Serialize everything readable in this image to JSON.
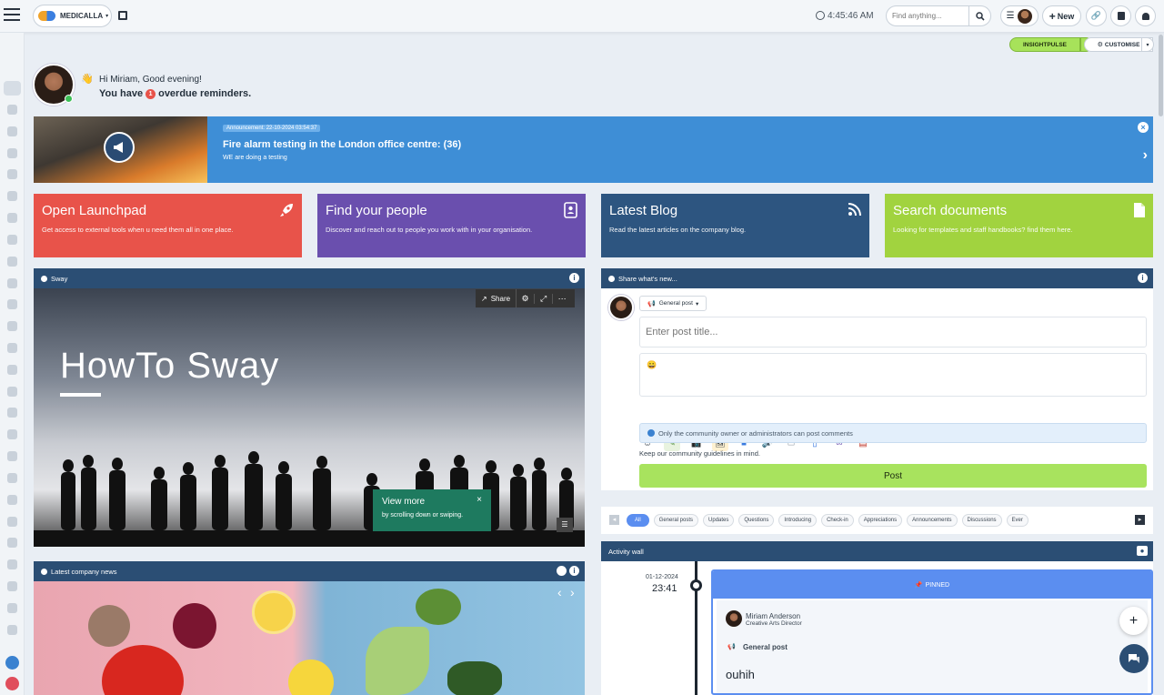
{
  "topbar": {
    "brand": "MEDICALLA",
    "time": "4:45:46 AM",
    "search_placeholder": "Find anything...",
    "new_label": "New"
  },
  "greeting": {
    "hello": "Hi Miriam, Good evening!",
    "reminder_prefix": "You have",
    "reminder_count": "1",
    "reminder_suffix": "overdue reminders."
  },
  "toolbar": {
    "insight_label": "INSIGHTPULSE",
    "customise_label": "CUSTOMISE"
  },
  "announcement": {
    "badge": "Announcement: 22-10-2024 03:54:37",
    "title": "Fire alarm testing in the London office centre: (36)",
    "text": "WE are doing a testing"
  },
  "quick_cards": [
    {
      "title": "Open Launchpad",
      "desc": "Get access to external tools when u need them all in one place.",
      "color": "#e8534a"
    },
    {
      "title": "Find your people",
      "desc": "Discover and reach out to people you work with in your organisation.",
      "color": "#6a4fae"
    },
    {
      "title": "Latest Blog",
      "desc": "Read the latest articles on the company blog.",
      "color": "#2d5580"
    },
    {
      "title": "Search documents",
      "desc": "Looking for templates and staff handbooks? find them here.",
      "color": "#a1d33f"
    }
  ],
  "sway": {
    "header": "Sway",
    "share_label": "Share",
    "title": "HowTo Sway",
    "tip_title": "View more",
    "tip_text": "by scrolling down or swiping."
  },
  "news": {
    "header": "Latest company news"
  },
  "composer": {
    "header": "Share what's new...",
    "post_type": "General post",
    "title_placeholder": "Enter post title...",
    "notice": "Only the community owner or administrators can post comments",
    "guidelines": "Keep our community guidelines in mind.",
    "post_label": "Post"
  },
  "filters": [
    "All",
    "General posts",
    "Updates",
    "Questions",
    "Introducing",
    "Check-in",
    "Appreciations",
    "Announcements",
    "Discussions",
    "Ever"
  ],
  "activity": {
    "header": "Activity wall",
    "date": "01-12-2024",
    "time": "23:41",
    "pinned_label": "PINNED",
    "author_name": "Miriam Anderson",
    "author_role": "Creative Arts Director",
    "post_type": "General post",
    "post_title": "ouhih"
  }
}
